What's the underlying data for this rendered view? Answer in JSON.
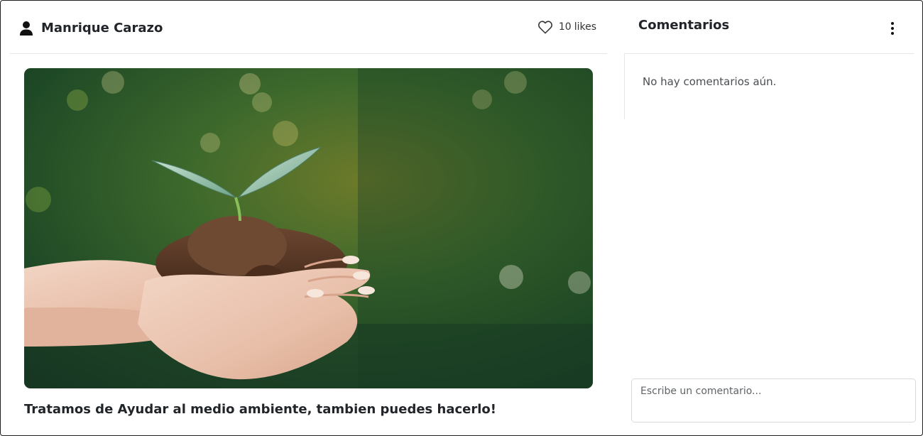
{
  "post": {
    "author_name": "Manrique Carazo",
    "author_icon": "user-icon",
    "likes_count": "10",
    "likes_label": "likes",
    "like_icon": "heart-outline-icon",
    "image_description": "hands holding soil with a green seedling",
    "caption": "Tratamos de Ayudar al medio ambiente, tambien puedes hacerlo!"
  },
  "comments": {
    "title": "Comentarios",
    "menu_icon": "kebab-menu-icon",
    "empty_text": "No hay comentarios aún.",
    "input_placeholder": "Escribe un comentario..."
  },
  "colors": {
    "border": "#e6e6e6",
    "text": "#212529",
    "muted": "#4a4f54"
  }
}
